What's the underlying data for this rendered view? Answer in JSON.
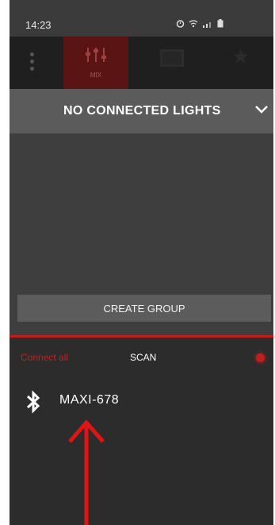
{
  "status_bar": {
    "time": "14:23",
    "icons": [
      "alarm-icon",
      "wifi-icon",
      "signal-icon",
      "battery-icon"
    ]
  },
  "nav": {
    "tabs": [
      {
        "id": "mix",
        "label": "MIX",
        "active": true,
        "icon": "sliders-icon"
      },
      {
        "id": "scenes",
        "label": "",
        "icon": "scenes-icon"
      },
      {
        "id": "favorites",
        "label": "",
        "icon": "star-icon"
      }
    ]
  },
  "lights_header": {
    "title": "NO CONNECTED LIGHTS",
    "icon": "chevron-down-icon"
  },
  "create_group": {
    "label": "CREATE GROUP"
  },
  "scan_bar": {
    "connect_all": "Connect all",
    "scan": "SCAN",
    "indicator_color": "#c41d1d"
  },
  "devices": [
    {
      "name": "MAXI-678",
      "icon": "bluetooth-icon"
    }
  ],
  "colors": {
    "accent": "#c21d1d",
    "background": "#3e3e3e",
    "header": "#5b5b5b"
  }
}
